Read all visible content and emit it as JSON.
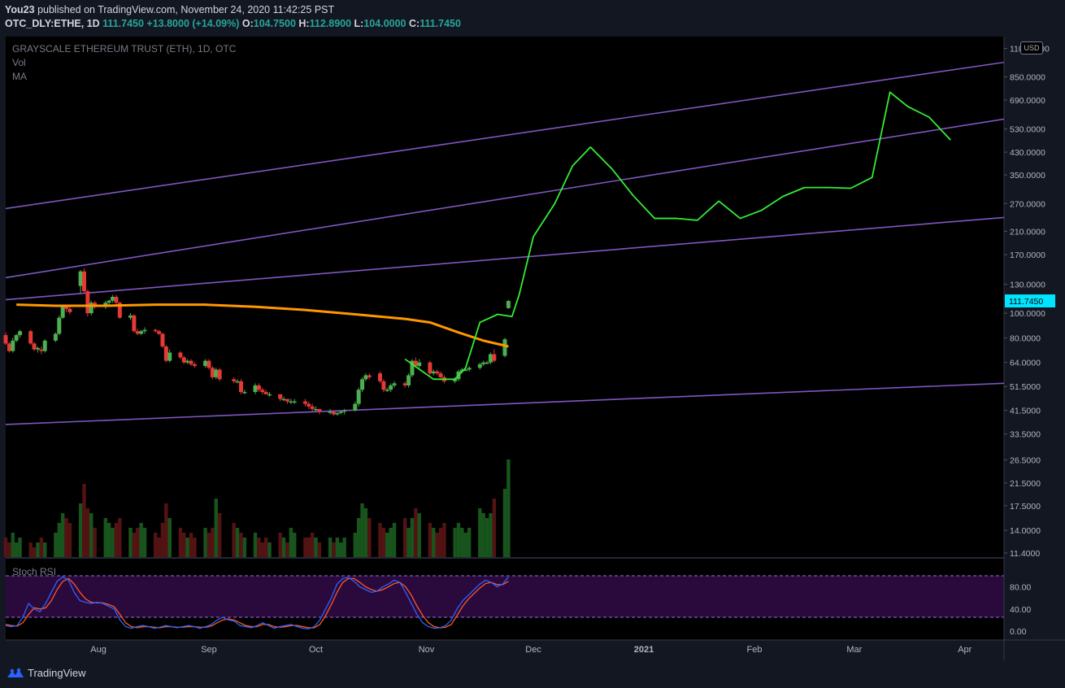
{
  "header": {
    "author": "You23",
    "published": "published on TradingView.com, November 24, 2020 11:42:25 PST",
    "symbol": "OTC_DLY:ETHE, 1D",
    "last": "111.7450",
    "change": "+13.8000 (+14.09%)",
    "o_label": "O:",
    "o_val": "104.7500",
    "h_label": "H:",
    "h_val": "112.8900",
    "l_label": "L:",
    "l_val": "104.0000",
    "c_label": "C:",
    "c_val": "111.7450"
  },
  "legend": {
    "title": "GRAYSCALE ETHEREUM TRUST (ETH), 1D, OTC",
    "vol": "Vol",
    "ma": "MA",
    "stoch": "Stoch RSI"
  },
  "currency": "USD",
  "brand": "TradingView",
  "colors": {
    "bg": "#000000",
    "up": "#26a69a",
    "up_candle": "#4caf50",
    "down": "#e53935",
    "ma": "#ff9800",
    "projection": "#33ee33",
    "channel": "#7e57c2",
    "stoch_k": "#2962ff",
    "stoch_d": "#ff5722",
    "stoch_band": "#2a0a3d",
    "price_label": "#00e5ff"
  },
  "chart_data": {
    "type": "line",
    "y_scale": "log",
    "y_ticks": [
      "11.4000",
      "14.0000",
      "17.5000",
      "21.5000",
      "26.5000",
      "33.5000",
      "41.5000",
      "51.5000",
      "64.0000",
      "80.0000",
      "100.0000",
      "130.0000",
      "170.0000",
      "210.0000",
      "270.0000",
      "350.0000",
      "430.0000",
      "530.0000",
      "690.0000",
      "850.0000",
      "1100.0000"
    ],
    "last_price_label": "111.7450",
    "x_ticks": [
      "Aug",
      "Sep",
      "Oct",
      "Nov",
      "Dec",
      "2021",
      "Feb",
      "Mar",
      "Apr"
    ],
    "x_tick_dates": [
      "2020-08-01",
      "2020-09-01",
      "2020-10-01",
      "2020-11-01",
      "2020-12-01",
      "2021-01-01",
      "2021-02-01",
      "2021-03-01",
      "2021-04-01"
    ],
    "x_range": [
      "2020-07-06",
      "2021-04-12"
    ],
    "y_range": [
      11.4,
      1180
    ],
    "candles": [
      {
        "d": "2020-07-06",
        "o": 82,
        "h": 84,
        "l": 75,
        "c": 76
      },
      {
        "d": "2020-07-07",
        "o": 76,
        "h": 77,
        "l": 70,
        "c": 71
      },
      {
        "d": "2020-07-08",
        "o": 71,
        "h": 80,
        "l": 70,
        "c": 78
      },
      {
        "d": "2020-07-09",
        "o": 78,
        "h": 83,
        "l": 77,
        "c": 82
      },
      {
        "d": "2020-07-10",
        "o": 82,
        "h": 86,
        "l": 80,
        "c": 85
      },
      {
        "d": "2020-07-13",
        "o": 85,
        "h": 86,
        "l": 75,
        "c": 76
      },
      {
        "d": "2020-07-14",
        "o": 76,
        "h": 77,
        "l": 71,
        "c": 72
      },
      {
        "d": "2020-07-15",
        "o": 72,
        "h": 74,
        "l": 70,
        "c": 73
      },
      {
        "d": "2020-07-16",
        "o": 72,
        "h": 74,
        "l": 69,
        "c": 71
      },
      {
        "d": "2020-07-17",
        "o": 71,
        "h": 79,
        "l": 70,
        "c": 78
      },
      {
        "d": "2020-07-20",
        "o": 78,
        "h": 84,
        "l": 77,
        "c": 83
      },
      {
        "d": "2020-07-21",
        "o": 83,
        "h": 98,
        "l": 82,
        "c": 96
      },
      {
        "d": "2020-07-22",
        "o": 96,
        "h": 108,
        "l": 95,
        "c": 106
      },
      {
        "d": "2020-07-23",
        "o": 106,
        "h": 108,
        "l": 101,
        "c": 104
      },
      {
        "d": "2020-07-24",
        "o": 104,
        "h": 106,
        "l": 99,
        "c": 101
      },
      {
        "d": "2020-07-27",
        "o": 128,
        "h": 148,
        "l": 120,
        "c": 146
      },
      {
        "d": "2020-07-28",
        "o": 146,
        "h": 150,
        "l": 120,
        "c": 122
      },
      {
        "d": "2020-07-29",
        "o": 122,
        "h": 124,
        "l": 97,
        "c": 100
      },
      {
        "d": "2020-07-30",
        "o": 100,
        "h": 112,
        "l": 98,
        "c": 110
      },
      {
        "d": "2020-07-31",
        "o": 110,
        "h": 112,
        "l": 104,
        "c": 106
      },
      {
        "d": "2020-08-03",
        "o": 106,
        "h": 112,
        "l": 104,
        "c": 110
      },
      {
        "d": "2020-08-04",
        "o": 110,
        "h": 113,
        "l": 106,
        "c": 112
      },
      {
        "d": "2020-08-05",
        "o": 112,
        "h": 118,
        "l": 110,
        "c": 116
      },
      {
        "d": "2020-08-06",
        "o": 116,
        "h": 118,
        "l": 108,
        "c": 110
      },
      {
        "d": "2020-08-07",
        "o": 110,
        "h": 111,
        "l": 95,
        "c": 96
      },
      {
        "d": "2020-08-10",
        "o": 96,
        "h": 100,
        "l": 94,
        "c": 98
      },
      {
        "d": "2020-08-11",
        "o": 98,
        "h": 99,
        "l": 84,
        "c": 85
      },
      {
        "d": "2020-08-12",
        "o": 85,
        "h": 87,
        "l": 82,
        "c": 83
      },
      {
        "d": "2020-08-13",
        "o": 83,
        "h": 86,
        "l": 82,
        "c": 85
      },
      {
        "d": "2020-08-14",
        "o": 85,
        "h": 88,
        "l": 83,
        "c": 86
      },
      {
        "d": "2020-08-17",
        "o": 86,
        "h": 87,
        "l": 84,
        "c": 85
      },
      {
        "d": "2020-08-18",
        "o": 85,
        "h": 86,
        "l": 82,
        "c": 83
      },
      {
        "d": "2020-08-19",
        "o": 83,
        "h": 84,
        "l": 73,
        "c": 74
      },
      {
        "d": "2020-08-20",
        "o": 74,
        "h": 75,
        "l": 64,
        "c": 65
      },
      {
        "d": "2020-08-21",
        "o": 65,
        "h": 72,
        "l": 64,
        "c": 70
      },
      {
        "d": "2020-08-24",
        "o": 70,
        "h": 71,
        "l": 66,
        "c": 67
      },
      {
        "d": "2020-08-25",
        "o": 67,
        "h": 68,
        "l": 63,
        "c": 64
      },
      {
        "d": "2020-08-26",
        "o": 64,
        "h": 66,
        "l": 63,
        "c": 65
      },
      {
        "d": "2020-08-27",
        "o": 65,
        "h": 66,
        "l": 62,
        "c": 63
      },
      {
        "d": "2020-08-28",
        "o": 63,
        "h": 64,
        "l": 61,
        "c": 62
      },
      {
        "d": "2020-08-31",
        "o": 62,
        "h": 66,
        "l": 61,
        "c": 65
      },
      {
        "d": "2020-09-01",
        "o": 65,
        "h": 66,
        "l": 60,
        "c": 61
      },
      {
        "d": "2020-09-02",
        "o": 61,
        "h": 62,
        "l": 55,
        "c": 56
      },
      {
        "d": "2020-09-03",
        "o": 56,
        "h": 61,
        "l": 55,
        "c": 60
      },
      {
        "d": "2020-09-04",
        "o": 60,
        "h": 61,
        "l": 54,
        "c": 55
      },
      {
        "d": "2020-09-08",
        "o": 55,
        "h": 56,
        "l": 53,
        "c": 54
      },
      {
        "d": "2020-09-09",
        "o": 54,
        "h": 55,
        "l": 53,
        "c": 54
      },
      {
        "d": "2020-09-10",
        "o": 54,
        "h": 55,
        "l": 48,
        "c": 49
      },
      {
        "d": "2020-09-11",
        "o": 49,
        "h": 50,
        "l": 48,
        "c": 49
      },
      {
        "d": "2020-09-14",
        "o": 49,
        "h": 53,
        "l": 48,
        "c": 52
      },
      {
        "d": "2020-09-15",
        "o": 52,
        "h": 53,
        "l": 49,
        "c": 50
      },
      {
        "d": "2020-09-16",
        "o": 50,
        "h": 51,
        "l": 48,
        "c": 49
      },
      {
        "d": "2020-09-17",
        "o": 49,
        "h": 50,
        "l": 48,
        "c": 48
      },
      {
        "d": "2020-09-18",
        "o": 48,
        "h": 49,
        "l": 47,
        "c": 48
      },
      {
        "d": "2020-09-21",
        "o": 48,
        "h": 48,
        "l": 45,
        "c": 46
      },
      {
        "d": "2020-09-22",
        "o": 46,
        "h": 47,
        "l": 45,
        "c": 46
      },
      {
        "d": "2020-09-23",
        "o": 46,
        "h": 46,
        "l": 44,
        "c": 45
      },
      {
        "d": "2020-09-24",
        "o": 45,
        "h": 46,
        "l": 44,
        "c": 45
      },
      {
        "d": "2020-09-25",
        "o": 45,
        "h": 46,
        "l": 44,
        "c": 45
      },
      {
        "d": "2020-09-28",
        "o": 45,
        "h": 46,
        "l": 43,
        "c": 44
      },
      {
        "d": "2020-09-29",
        "o": 44,
        "h": 45,
        "l": 42,
        "c": 43
      },
      {
        "d": "2020-09-30",
        "o": 43,
        "h": 44,
        "l": 41,
        "c": 42
      },
      {
        "d": "2020-10-01",
        "o": 42,
        "h": 43,
        "l": 41,
        "c": 42
      },
      {
        "d": "2020-10-02",
        "o": 42,
        "h": 42,
        "l": 40,
        "c": 41
      },
      {
        "d": "2020-10-05",
        "o": 41,
        "h": 42,
        "l": 40,
        "c": 41
      },
      {
        "d": "2020-10-06",
        "o": 41,
        "h": 41,
        "l": 39.5,
        "c": 40
      },
      {
        "d": "2020-10-07",
        "o": 40,
        "h": 41,
        "l": 39.5,
        "c": 40.5
      },
      {
        "d": "2020-10-08",
        "o": 40.5,
        "h": 41.5,
        "l": 40,
        "c": 41
      },
      {
        "d": "2020-10-09",
        "o": 41,
        "h": 42,
        "l": 40,
        "c": 41.5
      },
      {
        "d": "2020-10-12",
        "o": 41.5,
        "h": 45,
        "l": 41,
        "c": 44
      },
      {
        "d": "2020-10-13",
        "o": 44,
        "h": 51,
        "l": 43,
        "c": 50
      },
      {
        "d": "2020-10-14",
        "o": 50,
        "h": 56,
        "l": 49,
        "c": 55
      },
      {
        "d": "2020-10-15",
        "o": 55,
        "h": 58,
        "l": 54,
        "c": 57
      },
      {
        "d": "2020-10-16",
        "o": 57,
        "h": 58,
        "l": 55,
        "c": 56
      },
      {
        "d": "2020-10-19",
        "o": 58,
        "h": 59,
        "l": 53,
        "c": 54
      },
      {
        "d": "2020-10-20",
        "o": 54,
        "h": 55,
        "l": 49,
        "c": 50
      },
      {
        "d": "2020-10-21",
        "o": 50,
        "h": 51,
        "l": 49,
        "c": 50
      },
      {
        "d": "2020-10-22",
        "o": 50,
        "h": 53,
        "l": 49,
        "c": 52
      },
      {
        "d": "2020-10-23",
        "o": 52,
        "h": 54,
        "l": 51,
        "c": 53
      },
      {
        "d": "2020-10-26",
        "o": 53,
        "h": 54,
        "l": 51,
        "c": 52
      },
      {
        "d": "2020-10-27",
        "o": 52,
        "h": 58,
        "l": 51,
        "c": 57
      },
      {
        "d": "2020-10-28",
        "o": 57,
        "h": 66,
        "l": 56,
        "c": 65
      },
      {
        "d": "2020-10-29",
        "o": 65,
        "h": 67,
        "l": 61,
        "c": 62
      },
      {
        "d": "2020-10-30",
        "o": 62,
        "h": 66,
        "l": 61,
        "c": 64
      },
      {
        "d": "2020-11-02",
        "o": 64,
        "h": 65,
        "l": 57,
        "c": 58
      },
      {
        "d": "2020-11-03",
        "o": 58,
        "h": 60,
        "l": 57,
        "c": 59
      },
      {
        "d": "2020-11-04",
        "o": 59,
        "h": 60,
        "l": 57,
        "c": 58
      },
      {
        "d": "2020-11-05",
        "o": 58,
        "h": 59,
        "l": 55,
        "c": 56
      },
      {
        "d": "2020-11-06",
        "o": 56,
        "h": 57,
        "l": 53,
        "c": 54
      },
      {
        "d": "2020-11-09",
        "o": 54,
        "h": 56,
        "l": 53,
        "c": 55
      },
      {
        "d": "2020-11-10",
        "o": 55,
        "h": 60,
        "l": 54,
        "c": 59
      },
      {
        "d": "2020-11-11",
        "o": 59,
        "h": 61,
        "l": 58,
        "c": 60
      },
      {
        "d": "2020-11-12",
        "o": 60,
        "h": 61,
        "l": 59,
        "c": 60
      },
      {
        "d": "2020-11-13",
        "o": 60,
        "h": 62,
        "l": 59,
        "c": 61
      },
      {
        "d": "2020-11-16",
        "o": 61,
        "h": 64,
        "l": 60,
        "c": 63
      },
      {
        "d": "2020-11-17",
        "o": 63,
        "h": 65,
        "l": 62,
        "c": 64
      },
      {
        "d": "2020-11-18",
        "o": 64,
        "h": 65,
        "l": 63,
        "c": 64
      },
      {
        "d": "2020-11-19",
        "o": 64,
        "h": 70,
        "l": 63,
        "c": 69
      },
      {
        "d": "2020-11-20",
        "o": 69,
        "h": 72,
        "l": 64,
        "c": 65
      },
      {
        "d": "2020-11-23",
        "o": 68,
        "h": 80,
        "l": 67,
        "c": 79
      },
      {
        "d": "2020-11-24",
        "o": 104.75,
        "h": 112.89,
        "l": 104,
        "c": 111.745
      }
    ],
    "volume_relative": [
      0.2,
      0.15,
      0.25,
      0.15,
      0.2,
      0.15,
      0.1,
      0.15,
      0.2,
      0.15,
      0.25,
      0.35,
      0.45,
      0.4,
      0.35,
      0.55,
      0.75,
      0.5,
      0.45,
      0.3,
      0.4,
      0.35,
      0.3,
      0.35,
      0.4,
      0.3,
      0.25,
      0.3,
      0.35,
      0.3,
      0.25,
      0.2,
      0.35,
      0.55,
      0.4,
      0.3,
      0.25,
      0.2,
      0.25,
      0.2,
      0.3,
      0.25,
      0.3,
      0.6,
      0.45,
      0.35,
      0.3,
      0.25,
      0.2,
      0.25,
      0.2,
      0.15,
      0.2,
      0.15,
      0.25,
      0.2,
      0.15,
      0.3,
      0.25,
      0.2,
      0.2,
      0.25,
      0.2,
      0.15,
      0.2,
      0.15,
      0.2,
      0.15,
      0.2,
      0.25,
      0.4,
      0.55,
      0.5,
      0.4,
      0.35,
      0.3,
      0.25,
      0.3,
      0.35,
      0.4,
      0.3,
      0.4,
      0.5,
      0.45,
      0.35,
      0.3,
      0.25,
      0.3,
      0.35,
      0.3,
      0.35,
      0.3,
      0.25,
      0.3,
      0.5,
      0.45,
      0.4,
      0.45,
      0.6,
      0.7,
      1.0,
      0.55
    ],
    "ma": [
      {
        "d": "2020-07-09",
        "v": 108
      },
      {
        "d": "2020-07-20",
        "v": 107
      },
      {
        "d": "2020-08-03",
        "v": 107
      },
      {
        "d": "2020-08-17",
        "v": 108
      },
      {
        "d": "2020-08-31",
        "v": 108
      },
      {
        "d": "2020-09-14",
        "v": 106
      },
      {
        "d": "2020-09-28",
        "v": 103
      },
      {
        "d": "2020-10-12",
        "v": 99
      },
      {
        "d": "2020-10-26",
        "v": 95
      },
      {
        "d": "2020-11-02",
        "v": 92
      },
      {
        "d": "2020-11-10",
        "v": 84
      },
      {
        "d": "2020-11-17",
        "v": 78
      },
      {
        "d": "2020-11-24",
        "v": 74
      }
    ],
    "projection": [
      {
        "d": "2020-10-26",
        "v": 66
      },
      {
        "d": "2020-11-03",
        "v": 55
      },
      {
        "d": "2020-11-09",
        "v": 55
      },
      {
        "d": "2020-11-12",
        "v": 61
      },
      {
        "d": "2020-11-16",
        "v": 92
      },
      {
        "d": "2020-11-21",
        "v": 99
      },
      {
        "d": "2020-11-25",
        "v": 97
      },
      {
        "d": "2020-11-27",
        "v": 118
      },
      {
        "d": "2020-12-01",
        "v": 200
      },
      {
        "d": "2020-12-07",
        "v": 270
      },
      {
        "d": "2020-12-12",
        "v": 380
      },
      {
        "d": "2020-12-17",
        "v": 450
      },
      {
        "d": "2020-12-23",
        "v": 370
      },
      {
        "d": "2020-12-29",
        "v": 290
      },
      {
        "d": "2021-01-04",
        "v": 236
      },
      {
        "d": "2021-01-10",
        "v": 236
      },
      {
        "d": "2021-01-16",
        "v": 232
      },
      {
        "d": "2021-01-22",
        "v": 276
      },
      {
        "d": "2021-01-28",
        "v": 236
      },
      {
        "d": "2021-02-03",
        "v": 254
      },
      {
        "d": "2021-02-09",
        "v": 288
      },
      {
        "d": "2021-02-15",
        "v": 312
      },
      {
        "d": "2021-02-22",
        "v": 312
      },
      {
        "d": "2021-02-28",
        "v": 310
      },
      {
        "d": "2021-03-06",
        "v": 342
      },
      {
        "d": "2021-03-11",
        "v": 740
      },
      {
        "d": "2021-03-16",
        "v": 650
      },
      {
        "d": "2021-03-22",
        "v": 590
      },
      {
        "d": "2021-03-28",
        "v": 480
      }
    ],
    "trendlines": [
      {
        "from": {
          "d": "2020-07-06",
          "v": 258
        },
        "to": {
          "d": "2021-04-12",
          "v": 970
        }
      },
      {
        "from": {
          "d": "2020-07-06",
          "v": 138
        },
        "to": {
          "d": "2021-04-12",
          "v": 580
        }
      },
      {
        "from": {
          "d": "2020-07-06",
          "v": 113
        },
        "to": {
          "d": "2021-04-12",
          "v": 238
        }
      },
      {
        "from": {
          "d": "2020-07-06",
          "v": 36.5
        },
        "to": {
          "d": "2021-04-12",
          "v": 53
        }
      }
    ],
    "stoch_rsi": {
      "levels": [
        80,
        20
      ],
      "y_ticks": [
        "80.00",
        "40.00",
        "0.00"
      ],
      "k": [
        10,
        8,
        10,
        25,
        50,
        40,
        35,
        50,
        70,
        90,
        98,
        92,
        70,
        55,
        52,
        50,
        52,
        50,
        45,
        40,
        20,
        8,
        5,
        8,
        10,
        8,
        5,
        7,
        10,
        8,
        6,
        8,
        10,
        8,
        5,
        8,
        12,
        20,
        25,
        20,
        18,
        10,
        8,
        6,
        10,
        15,
        10,
        5,
        8,
        10,
        12,
        8,
        5,
        4,
        8,
        20,
        40,
        60,
        85,
        95,
        97,
        90,
        80,
        75,
        70,
        72,
        80,
        85,
        92,
        88,
        70,
        50,
        30,
        15,
        8,
        5,
        6,
        10,
        20,
        40,
        55,
        65,
        75,
        85,
        92,
        88,
        80,
        85,
        98
      ],
      "d": [
        12,
        10,
        9,
        15,
        30,
        42,
        40,
        42,
        55,
        75,
        90,
        95,
        85,
        70,
        58,
        52,
        51,
        51,
        48,
        44,
        30,
        15,
        8,
        6,
        8,
        8,
        7,
        6,
        8,
        8,
        7,
        7,
        8,
        8,
        7,
        7,
        9,
        15,
        20,
        22,
        20,
        15,
        10,
        8,
        8,
        12,
        12,
        8,
        7,
        8,
        10,
        10,
        8,
        6,
        6,
        12,
        28,
        48,
        70,
        88,
        95,
        95,
        88,
        80,
        75,
        72,
        75,
        80,
        86,
        88,
        80,
        65,
        45,
        28,
        15,
        8,
        6,
        7,
        12,
        28,
        45,
        58,
        68,
        78,
        86,
        88,
        84,
        84,
        90
      ]
    }
  }
}
